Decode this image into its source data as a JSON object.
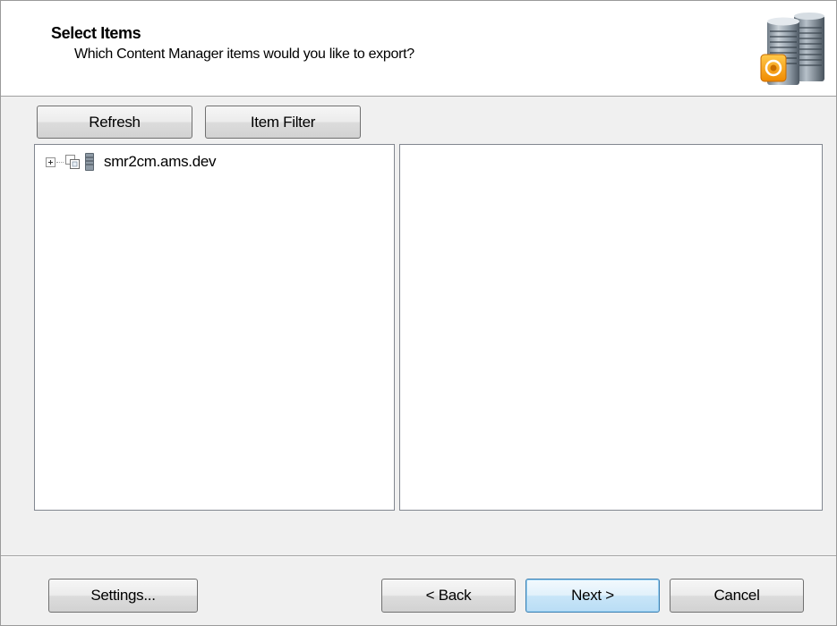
{
  "header": {
    "title": "Select Items",
    "subtitle": "Which Content Manager items would you like to export?",
    "logo_icon": "server-export-icon"
  },
  "toolbar": {
    "refresh_label": "Refresh",
    "item_filter_label": "Item Filter"
  },
  "tree": {
    "nodes": [
      {
        "label": "smr2cm.ams.dev",
        "expanded": false,
        "icons": [
          "expand-plus-icon",
          "checkbox-items-icon",
          "server-icon"
        ]
      }
    ]
  },
  "footer": {
    "settings_label": "Settings...",
    "back_label": "< Back",
    "next_label": "Next >",
    "cancel_label": "Cancel"
  },
  "colors": {
    "header_bg": "#ffffff",
    "window_bg": "#f0f0f0",
    "default_button_border": "#3c7fb1",
    "logo_accent": "#f5a623"
  }
}
